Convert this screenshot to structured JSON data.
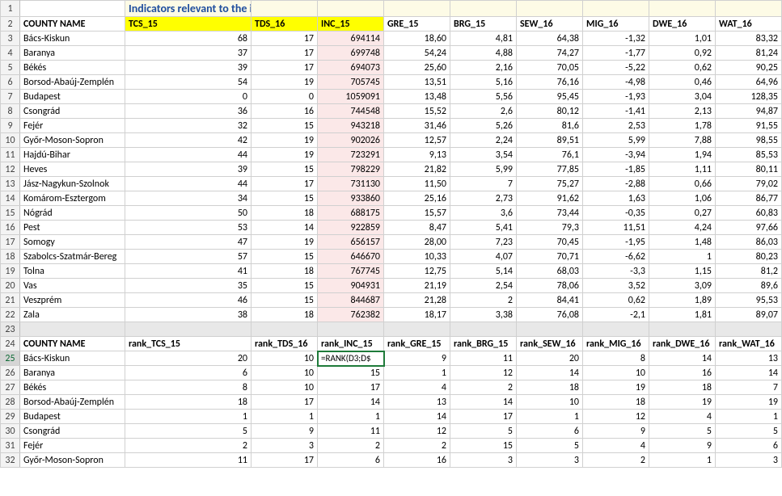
{
  "title": "Indicators relevant to the inhabitants",
  "columns": [
    "COUNTY NAME",
    "TCS_15",
    "TDS_16",
    "INC_15",
    "GRE_15",
    "BRG_15",
    "SEW_16",
    "MIG_16",
    "DWE_16",
    "WAT_16"
  ],
  "highlight_cols": [
    "TCS_15",
    "TDS_16",
    "INC_15"
  ],
  "data_rows": [
    {
      "n": "Bács-Kiskun",
      "v": [
        68,
        17,
        694114,
        "18,60",
        "4,81",
        "64,38",
        "-1,32",
        "1,01",
        "83,32"
      ]
    },
    {
      "n": "Baranya",
      "v": [
        37,
        17,
        699748,
        "54,24",
        "4,88",
        "74,27",
        "-1,77",
        "0,92",
        "81,24"
      ]
    },
    {
      "n": "Békés",
      "v": [
        39,
        17,
        694073,
        "25,60",
        "2,16",
        "70,05",
        "-5,22",
        "0,62",
        "90,25"
      ]
    },
    {
      "n": "Borsod-Abaúj-Zemplén",
      "v": [
        54,
        19,
        705745,
        "13,51",
        "5,16",
        "76,16",
        "-4,98",
        "0,46",
        "64,96"
      ]
    },
    {
      "n": "Budapest",
      "v": [
        0,
        0,
        1059091,
        "13,48",
        "5,56",
        "95,45",
        "-1,93",
        "3,04",
        "128,35"
      ]
    },
    {
      "n": "Csongrád",
      "v": [
        36,
        16,
        744548,
        "15,52",
        "2,6",
        "80,12",
        "-1,41",
        "2,13",
        "94,87"
      ]
    },
    {
      "n": "Fejér",
      "v": [
        32,
        15,
        943218,
        "31,46",
        "5,26",
        "81,6",
        "2,53",
        "1,78",
        "91,55"
      ]
    },
    {
      "n": "Győr-Moson-Sopron",
      "v": [
        42,
        19,
        902026,
        "12,57",
        "2,24",
        "89,51",
        "5,99",
        "7,88",
        "98,55"
      ]
    },
    {
      "n": "Hajdú-Bihar",
      "v": [
        44,
        19,
        723291,
        "9,13",
        "3,54",
        "76,1",
        "-3,94",
        "1,94",
        "85,53"
      ]
    },
    {
      "n": "Heves",
      "v": [
        39,
        15,
        798229,
        "21,82",
        "5,99",
        "77,85",
        "-1,85",
        "1,11",
        "80,11"
      ]
    },
    {
      "n": "Jász-Nagykun-Szolnok",
      "v": [
        44,
        17,
        731130,
        "11,50",
        "7",
        "75,27",
        "-2,88",
        "0,66",
        "79,02"
      ]
    },
    {
      "n": "Komárom-Esztergom",
      "v": [
        34,
        15,
        933860,
        "25,16",
        "2,73",
        "91,62",
        "1,63",
        "1,06",
        "86,77"
      ]
    },
    {
      "n": "Nógrád",
      "v": [
        50,
        18,
        688175,
        "15,57",
        "3,6",
        "73,44",
        "-0,35",
        "0,27",
        "60,83"
      ]
    },
    {
      "n": "Pest",
      "v": [
        53,
        14,
        922859,
        "8,47",
        "5,41",
        "79,3",
        "11,51",
        "4,24",
        "97,66"
      ]
    },
    {
      "n": "Somogy",
      "v": [
        47,
        19,
        656157,
        "28,00",
        "7,23",
        "70,45",
        "-1,95",
        "1,48",
        "86,03"
      ]
    },
    {
      "n": "Szabolcs-Szatmár-Bereg",
      "v": [
        57,
        15,
        646670,
        "10,33",
        "4,07",
        "70,71",
        "-6,62",
        "1",
        "80,23"
      ]
    },
    {
      "n": "Tolna",
      "v": [
        41,
        18,
        767745,
        "12,75",
        "5,14",
        "68,03",
        "-3,3",
        "1,15",
        "81,2"
      ]
    },
    {
      "n": "Vas",
      "v": [
        35,
        15,
        904931,
        "21,19",
        "2,54",
        "78,06",
        "3,52",
        "3,09",
        "89,6"
      ]
    },
    {
      "n": "Veszprém",
      "v": [
        46,
        15,
        844687,
        "21,28",
        "2",
        "84,41",
        "0,62",
        "1,89",
        "95,53"
      ]
    },
    {
      "n": "Zala",
      "v": [
        38,
        18,
        762382,
        "18,17",
        "3,38",
        "76,08",
        "-2,1",
        "1,81",
        "89,07"
      ]
    }
  ],
  "rank_columns": [
    "COUNTY NAME",
    "rank_TCS_15",
    "rank_TDS_16",
    "rank_INC_15",
    "rank_GRE_15",
    "rank_BRG_15",
    "rank_SEW_16",
    "rank_MIG_16",
    "rank_DWE_16",
    "rank_WAT_16"
  ],
  "formula_cell": "=RANK(D3;D$",
  "rank_rows": [
    {
      "n": "Bács-Kiskun",
      "v": [
        20,
        10,
        null,
        9,
        11,
        20,
        8,
        14,
        13
      ]
    },
    {
      "n": "Baranya",
      "v": [
        6,
        10,
        15,
        1,
        12,
        14,
        10,
        16,
        14
      ]
    },
    {
      "n": "Békés",
      "v": [
        8,
        10,
        17,
        4,
        2,
        18,
        19,
        18,
        7
      ]
    },
    {
      "n": "Borsod-Abaúj-Zemplén",
      "v": [
        18,
        17,
        14,
        13,
        14,
        10,
        18,
        19,
        19
      ]
    },
    {
      "n": "Budapest",
      "v": [
        1,
        1,
        1,
        14,
        17,
        1,
        12,
        4,
        1
      ]
    },
    {
      "n": "Csongrád",
      "v": [
        5,
        9,
        11,
        12,
        5,
        6,
        9,
        5,
        5
      ]
    },
    {
      "n": "Fejér",
      "v": [
        2,
        3,
        2,
        2,
        15,
        5,
        4,
        9,
        6
      ]
    },
    {
      "n": "Győr-Moson-Sopron",
      "v": [
        11,
        17,
        6,
        16,
        3,
        3,
        2,
        1,
        3
      ]
    }
  ],
  "selected_row_label": "25"
}
